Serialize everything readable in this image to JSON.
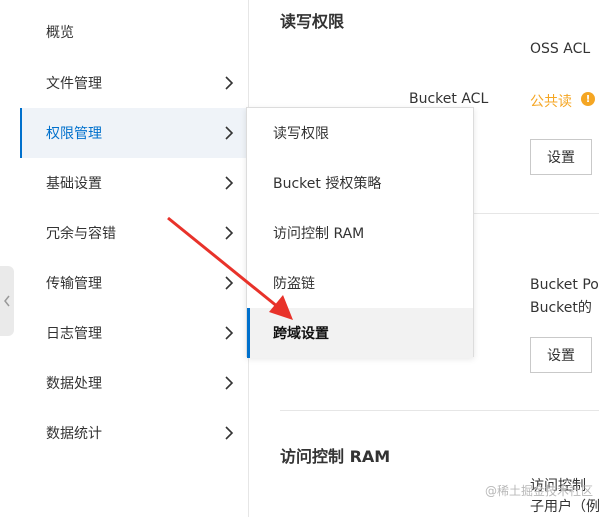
{
  "sidebar": {
    "items": [
      {
        "label": "概览",
        "has_chevron": false
      },
      {
        "label": "文件管理",
        "has_chevron": true
      },
      {
        "label": "权限管理",
        "has_chevron": true,
        "active": true
      },
      {
        "label": "基础设置",
        "has_chevron": true
      },
      {
        "label": "冗余与容错",
        "has_chevron": true
      },
      {
        "label": "传输管理",
        "has_chevron": true
      },
      {
        "label": "日志管理",
        "has_chevron": true
      },
      {
        "label": "数据处理",
        "has_chevron": true
      },
      {
        "label": "数据统计",
        "has_chevron": true
      }
    ],
    "collapse_icon": "chevron-left-icon"
  },
  "submenu": {
    "items": [
      {
        "label": "读写权限"
      },
      {
        "label": "Bucket 授权策略"
      },
      {
        "label": "访问控制 RAM"
      },
      {
        "label": "防盗链"
      },
      {
        "label": "跨域设置",
        "active": true
      }
    ]
  },
  "main": {
    "acl_section": {
      "title": "读写权限",
      "oss_acl_label": "OSS ACL",
      "bucket_acl_label": "Bucket ACL",
      "bucket_acl_value": "公共读",
      "settings_button": "设置"
    },
    "policy_section": {
      "line1": "Bucket Po",
      "line2": "Bucket的",
      "settings_button": "设置"
    },
    "ram_section": {
      "title": "访问控制 RAM",
      "line1": "访问控制",
      "line2": "子用户（例"
    }
  },
  "watermark": "@稀土掘金技术社区",
  "colors": {
    "accent": "#0070cc",
    "warning": "#f5a623",
    "arrow": "#e8322a",
    "active_bg": "#eff3f8"
  }
}
